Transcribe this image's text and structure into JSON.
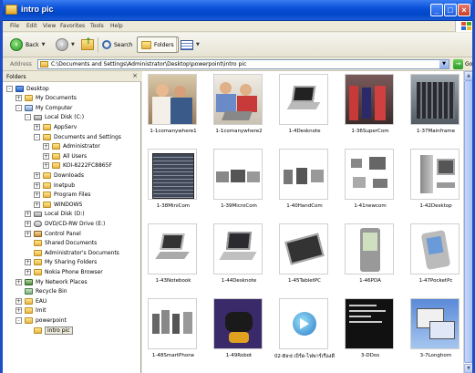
{
  "window": {
    "title": "intro pic",
    "controls": {
      "minimize": "_",
      "maximize": "□",
      "close": "×"
    }
  },
  "menu": [
    "File",
    "Edit",
    "View",
    "Favorites",
    "Tools",
    "Help"
  ],
  "toolbar": {
    "back_label": "Back",
    "search_label": "Search",
    "folders_label": "Folders"
  },
  "address": {
    "label": "Address",
    "path": "C:\\Documents and Settings\\Administrator\\Desktop\\powerpoint\\intro pic",
    "go_label": "Go"
  },
  "folders_pane": {
    "title": "Folders",
    "close": "×",
    "tree": [
      {
        "label": "Desktop",
        "icon": "desktop",
        "expander": "-",
        "indent": 0
      },
      {
        "label": "My Documents",
        "icon": "folder",
        "expander": "+",
        "indent": 1
      },
      {
        "label": "My Computer",
        "icon": "computer",
        "expander": "-",
        "indent": 1
      },
      {
        "label": "Local Disk (C:)",
        "icon": "drive",
        "expander": "-",
        "indent": 2
      },
      {
        "label": "AppServ",
        "icon": "folder",
        "expander": "+",
        "indent": 3
      },
      {
        "label": "Documents and Settings",
        "icon": "folder",
        "expander": "-",
        "indent": 3
      },
      {
        "label": "Administrator",
        "icon": "folder",
        "expander": "+",
        "indent": 4
      },
      {
        "label": "All Users",
        "icon": "folder",
        "expander": "+",
        "indent": 4
      },
      {
        "label": "KOI-8222FC8865F",
        "icon": "folder",
        "expander": "+",
        "indent": 4
      },
      {
        "label": "Downloads",
        "icon": "folder",
        "expander": "+",
        "indent": 3
      },
      {
        "label": "Inetpub",
        "icon": "folder",
        "expander": "+",
        "indent": 3
      },
      {
        "label": "Program Files",
        "icon": "folder",
        "expander": "+",
        "indent": 3
      },
      {
        "label": "WINDOWS",
        "icon": "folder",
        "expander": "+",
        "indent": 3
      },
      {
        "label": "Local Disk (D:)",
        "icon": "drive",
        "expander": "+",
        "indent": 2
      },
      {
        "label": "DVD/CD-RW Drive (E:)",
        "icon": "dvd",
        "expander": "+",
        "indent": 2
      },
      {
        "label": "Control Panel",
        "icon": "cp",
        "expander": "+",
        "indent": 2
      },
      {
        "label": "Shared Documents",
        "icon": "folder",
        "expander": "",
        "indent": 2
      },
      {
        "label": "Administrator's Documents",
        "icon": "folder",
        "expander": "",
        "indent": 2
      },
      {
        "label": "My Sharing Folders",
        "icon": "folder",
        "expander": "+",
        "indent": 2
      },
      {
        "label": "Nokia Phone Browser",
        "icon": "folder",
        "expander": "+",
        "indent": 2
      },
      {
        "label": "My Network Places",
        "icon": "network",
        "expander": "+",
        "indent": 1
      },
      {
        "label": "Recycle Bin",
        "icon": "recycle",
        "expander": "",
        "indent": 1
      },
      {
        "label": "EAU",
        "icon": "folder",
        "expander": "+",
        "indent": 1
      },
      {
        "label": "lmit",
        "icon": "folder",
        "expander": "+",
        "indent": 1
      },
      {
        "label": "powerpoint",
        "icon": "folder",
        "expander": "-",
        "indent": 1
      },
      {
        "label": "intro pic",
        "icon": "folder",
        "expander": "",
        "indent": 2,
        "selected": true
      }
    ]
  },
  "files": [
    {
      "name": "1-1comanywhere1",
      "art": "people"
    },
    {
      "name": "1-1comanywhere2",
      "art": "people2"
    },
    {
      "name": "1-4Desknote",
      "art": "laptop"
    },
    {
      "name": "1-36SuperCom",
      "art": "room"
    },
    {
      "name": "1-37Mainframe",
      "art": "mainframe"
    },
    {
      "name": "1-38MiniCom",
      "art": "rack"
    },
    {
      "name": "1-39MicroCom",
      "art": "desktops"
    },
    {
      "name": "1-40HandCom",
      "art": "handhelds"
    },
    {
      "name": "1-41newcom",
      "art": "newcom"
    },
    {
      "name": "1-42Desktop",
      "art": "tower"
    },
    {
      "name": "1-43Notebook",
      "art": "notebook"
    },
    {
      "name": "1-44Desknote",
      "art": "laptop2"
    },
    {
      "name": "1-45TabletPC",
      "art": "tablet"
    },
    {
      "name": "1-46PDA",
      "art": "pda"
    },
    {
      "name": "1-47PocketPc",
      "art": "pocketpc"
    },
    {
      "name": "1-48SmartPhone",
      "art": "phones"
    },
    {
      "name": "1-49Robot",
      "art": "robot"
    },
    {
      "name": "02-Bird เบิร์ด-ไฟพาร์เรื่องดี",
      "art": "media"
    },
    {
      "name": "3-DDos",
      "art": "dos"
    },
    {
      "name": "3-7Longhorn",
      "art": "longhorn"
    }
  ]
}
